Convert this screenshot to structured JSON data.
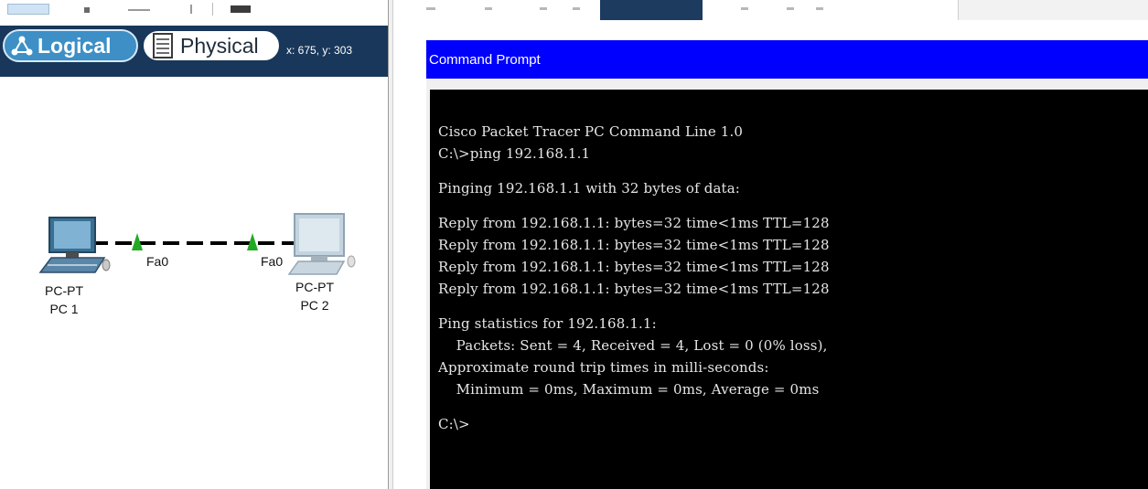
{
  "workspace": {
    "modes": {
      "logical": "Logical",
      "physical": "Physical"
    },
    "coordinates": "x: 675, y: 303",
    "devices": [
      {
        "model": "PC-PT",
        "name": "PC 1",
        "port": "Fa0"
      },
      {
        "model": "PC-PT",
        "name": "PC 2",
        "port": "Fa0"
      }
    ],
    "link_status_color": "#22aa22"
  },
  "command_prompt": {
    "title": "Command Prompt",
    "lines": [
      "Cisco Packet Tracer PC Command Line 1.0",
      "C:\\>ping 192.168.1.1",
      "",
      "Pinging 192.168.1.1 with 32 bytes of data:",
      "",
      "Reply from 192.168.1.1: bytes=32 time<1ms TTL=128",
      "Reply from 192.168.1.1: bytes=32 time<1ms TTL=128",
      "Reply from 192.168.1.1: bytes=32 time<1ms TTL=128",
      "Reply from 192.168.1.1: bytes=32 time<1ms TTL=128",
      "",
      "Ping statistics for 192.168.1.1:",
      "    Packets: Sent = 4, Received = 4, Lost = 0 (0% loss),",
      "Approximate round trip times in milli-seconds:",
      "    Minimum = 0ms, Maximum = 0ms, Average = 0ms",
      "",
      "C:\\>"
    ]
  },
  "colors": {
    "title_bar": "#0000ff",
    "mode_bar": "#18375a",
    "logical_active": "#3d8fc6"
  }
}
